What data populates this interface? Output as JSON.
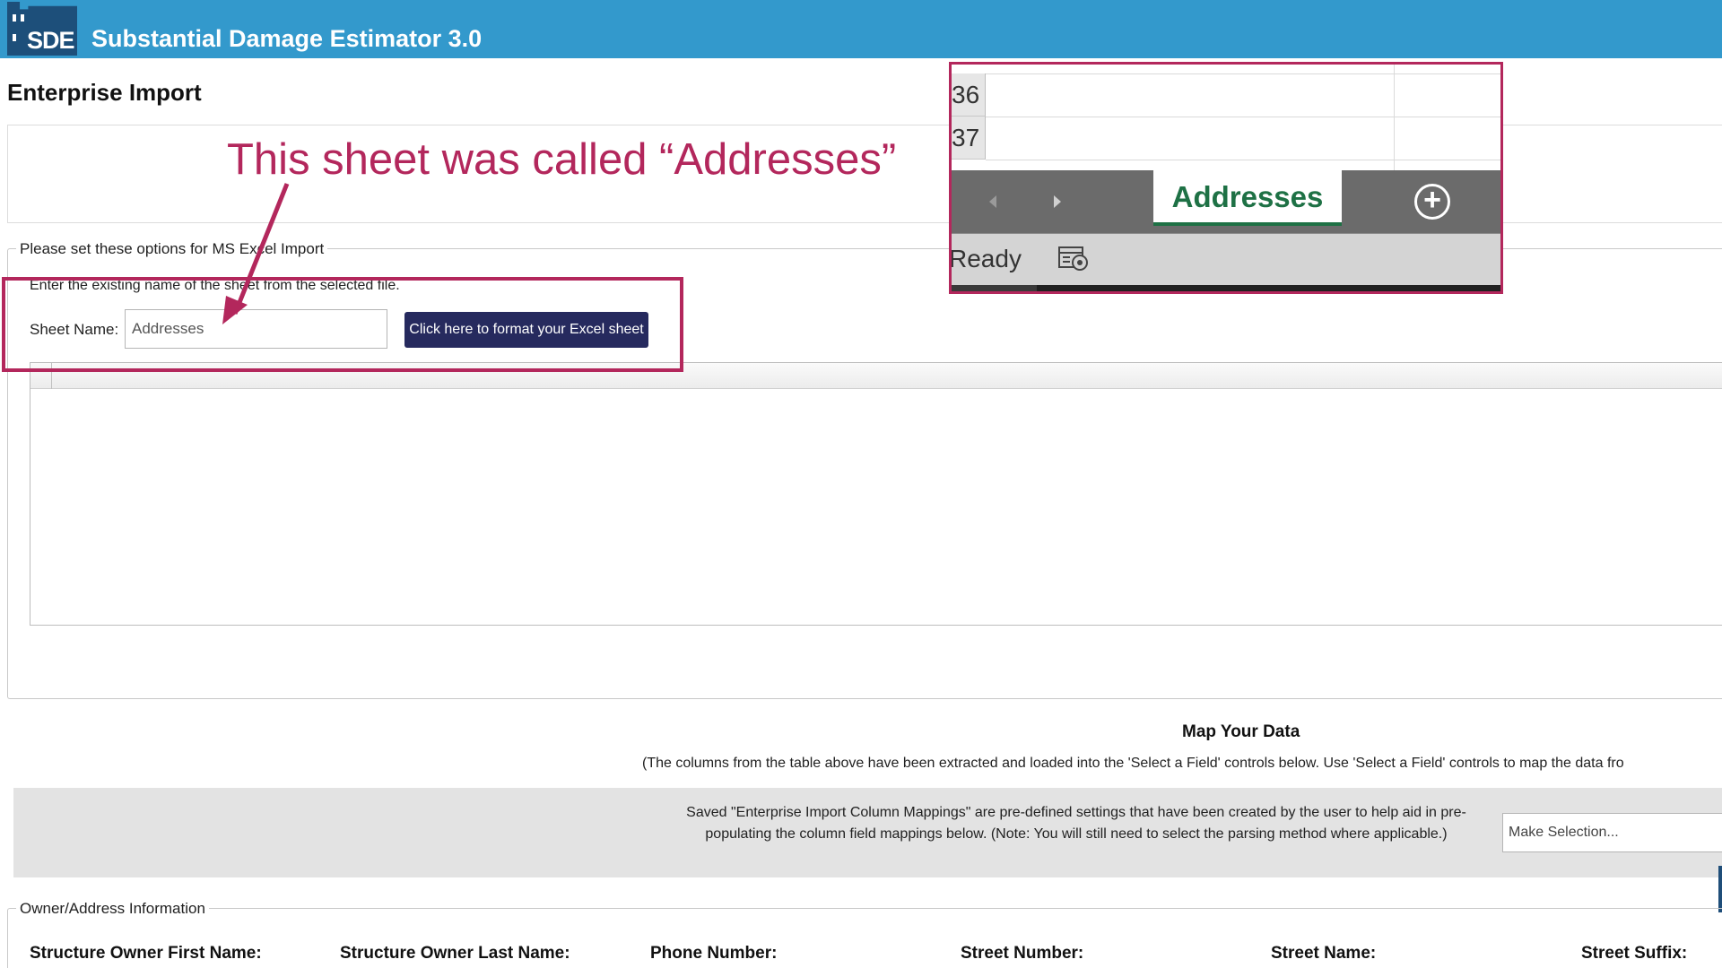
{
  "app": {
    "logo_text": "SDE",
    "title": "Substantial Damage Estimator 3.0"
  },
  "page": {
    "title": "Enterprise Import"
  },
  "excel_options": {
    "legend": "Please set these options for MS Excel Import",
    "hint": "Enter the existing name of the sheet from the selected file.",
    "sheet_name_label": "Sheet Name:",
    "sheet_name_value": "Addresses",
    "format_button": "Click here to format your Excel sheet"
  },
  "annotation": {
    "text": "This sheet was called “Addresses”",
    "color": "#b3275c"
  },
  "excel_inset": {
    "row_numbers": [
      "36",
      "37"
    ],
    "sheet_tab": "Addresses",
    "add_sheet_symbol": "+",
    "status": "Ready",
    "prev_icon": "triangle-left-icon",
    "next_icon": "triangle-right-icon",
    "accent_color": "#1e7145"
  },
  "map_data": {
    "title": "Map Your Data",
    "description": "(The columns from the table above have been extracted and loaded into the 'Select a Field' controls below. Use 'Select a Field' controls to map the data fro",
    "saved_text": "Saved \"Enterprise Import Column Mappings\" are pre-defined settings that have been created by the user to help aid in pre-populating the column field mappings below. (Note: You will still need to select the parsing method where applicable.)",
    "mapping_select": "Make Selection..."
  },
  "owner_info": {
    "legend": "Owner/Address Information",
    "fields": [
      "Structure Owner First Name:",
      "Structure Owner Last Name:",
      "Phone Number:",
      "Street Number:",
      "Street Name:",
      "Street Suffix:"
    ]
  },
  "colors": {
    "titlebar": "#3399cc",
    "button": "#262a5e"
  }
}
